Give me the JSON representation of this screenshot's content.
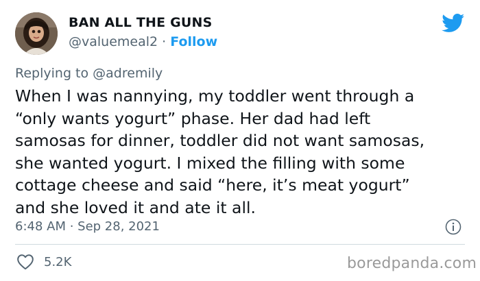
{
  "author": {
    "display_name": "BAN ALL THE GUNS",
    "handle": "@valuemeal2",
    "separator": " · ",
    "follow_label": "Follow"
  },
  "replying_to": "Replying to @adremily",
  "body_lines": [
    "When I was nannying, my toddler went through a",
    "“only wants yogurt” phase. Her dad had left",
    "samosas for dinner, toddler did not want samosas,",
    "she wanted yogurt. I mixed the filling with some",
    "cottage cheese and said “here, it’s meat yogurt”",
    "and she loved it and ate it all."
  ],
  "timestamp": "6:48 AM · Sep 28, 2021",
  "likes": "5.2K",
  "watermark": "boredpanda.com",
  "colors": {
    "accent": "#1d9bf0",
    "secondary_text": "#536471",
    "primary_text": "#0f1419"
  },
  "icons": {
    "brand": "twitter-bird-icon",
    "info": "info-icon",
    "like": "heart-icon"
  }
}
